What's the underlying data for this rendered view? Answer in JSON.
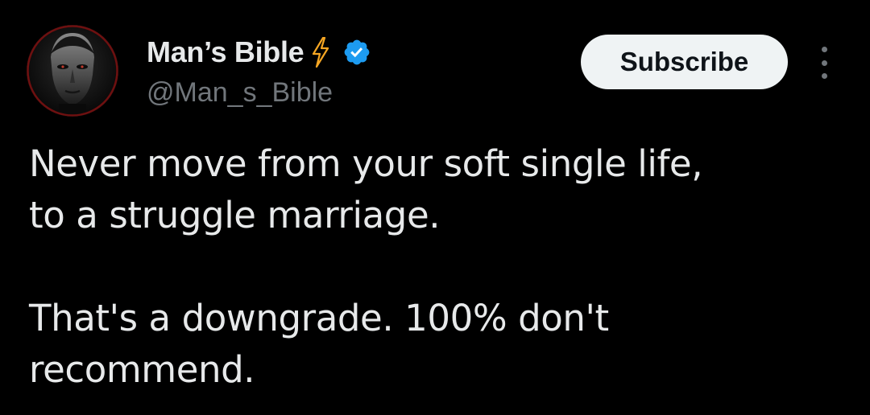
{
  "header": {
    "display_name": "Man’s Bible",
    "handle": "@Man_s_Bible",
    "subscribe_label": "Subscribe",
    "icons": {
      "badge": "lightning-bolt-icon",
      "verified": "verified-checkmark-icon",
      "more": "more-vertical-icon"
    }
  },
  "tweet": {
    "paragraphs": [
      "Never move from your soft single life,\nto a struggle marriage.",
      "That's a downgrade. 100% don't\nrecommend."
    ]
  },
  "colors": {
    "background": "#000000",
    "text": "#e7e9ea",
    "secondary_text": "#71767b",
    "verified_blue": "#1d9bf0",
    "bolt_orange": "#f5a623",
    "subscribe_bg": "#eff3f4"
  }
}
